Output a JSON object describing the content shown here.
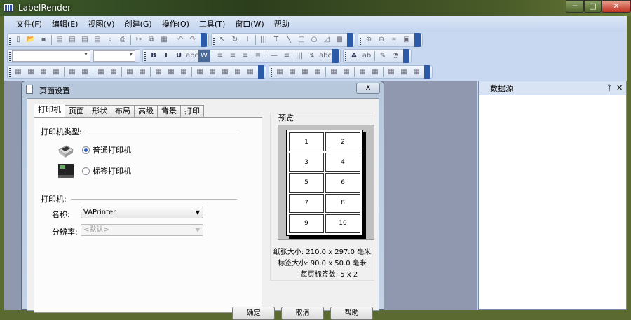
{
  "app": {
    "title": "LabelRender",
    "min": "─",
    "max": "□",
    "close": "✕"
  },
  "menu": [
    "文件(F)",
    "编辑(E)",
    "视图(V)",
    "创建(G)",
    "操作(O)",
    "工具(T)",
    "窗口(W)",
    "帮助"
  ],
  "toolbars": {
    "row1": [
      [
        "new",
        "open",
        "save",
        "|",
        "page",
        "page2",
        "page3",
        "print-setup",
        "preview",
        "print",
        "|",
        "cut",
        "copy",
        "paste",
        "|",
        "undo",
        "redo"
      ],
      [
        "pointer",
        "rotate",
        "text-cursor",
        "|",
        "barcode",
        "text",
        "line",
        "rectangle",
        "ellipse",
        "polygon",
        "image"
      ],
      [
        "zoom-in",
        "zoom-out",
        "fit",
        "actual"
      ]
    ],
    "row2_format": [
      "B",
      "I",
      "U",
      "abc",
      "W",
      "|",
      "align-left",
      "align-center",
      "align-right",
      "justify",
      "|",
      "—",
      "≡",
      "|||",
      "rotate-text",
      "abc-small"
    ],
    "row2_color": [
      "A",
      "fill-color",
      "|",
      "line-color",
      "shadow-color"
    ],
    "row3": [
      [
        "align-left-edge",
        "align-top",
        "align-middle",
        "align-bottom",
        "|",
        "center-h",
        "center-v",
        "|",
        "space-h",
        "space-v",
        "|",
        "same-width",
        "same-height",
        "|",
        "group",
        "ungroup",
        "grid",
        "|",
        "r1",
        "r2",
        "r3",
        "r4",
        "r5"
      ],
      [
        "front",
        "back",
        "forward",
        "backward",
        "|",
        "lock",
        "unlock",
        "|",
        "show",
        "hide",
        "|",
        "up",
        "down",
        "tag"
      ]
    ]
  },
  "glyphs": {
    "new": "▯",
    "open": "📂",
    "save": "▪",
    "page": "▤",
    "page2": "▤",
    "page3": "▤",
    "print-setup": "▤",
    "preview": "⌕",
    "print": "⎙",
    "cut": "✂",
    "copy": "⧉",
    "paste": "▦",
    "undo": "↶",
    "redo": "↷",
    "pointer": "↖",
    "rotate": "↻",
    "text-cursor": "I",
    "barcode": "|||",
    "text": "T",
    "line": "╲",
    "rectangle": "□",
    "ellipse": "○",
    "polygon": "◿",
    "image": "▩",
    "zoom-in": "⊕",
    "zoom-out": "⊖",
    "fit": "⌗",
    "actual": "▣",
    "align-left": "≡",
    "align-center": "≡",
    "align-right": "≡",
    "justify": "≣",
    "rotate-text": "↯",
    "abc-small": "abc",
    "fill-color": "ab",
    "line-color": "✎",
    "shadow-color": "◔"
  },
  "datasource": {
    "title": "数据源",
    "pin": "ᛘ",
    "close": "✕"
  },
  "dialog": {
    "title": "页面设置",
    "close": "X",
    "tabs": [
      "打印机",
      "页面",
      "形状",
      "布局",
      "高级",
      "背景",
      "打印"
    ],
    "printer_type_label": "打印机类型:",
    "radio_normal": "普通打印机",
    "radio_label": "标签打印机",
    "selected": "normal",
    "printer_label": "打印机:",
    "name_label": "名称:",
    "name_value": "VAPrinter",
    "resolution_label": "分辨率:",
    "resolution_value": "<默认>",
    "preview_title": "预览",
    "cells": [
      "1",
      "2",
      "3",
      "4",
      "5",
      "6",
      "7",
      "8",
      "9",
      "10"
    ],
    "paper_size": "纸张大小: 210.0 x 297.0 毫米",
    "label_size": "标签大小: 90.0 x 50.0 毫米",
    "labels_per_page": "每页标签数: 5 x 2",
    "ok": "确定",
    "cancel": "取消",
    "help": "帮助"
  }
}
